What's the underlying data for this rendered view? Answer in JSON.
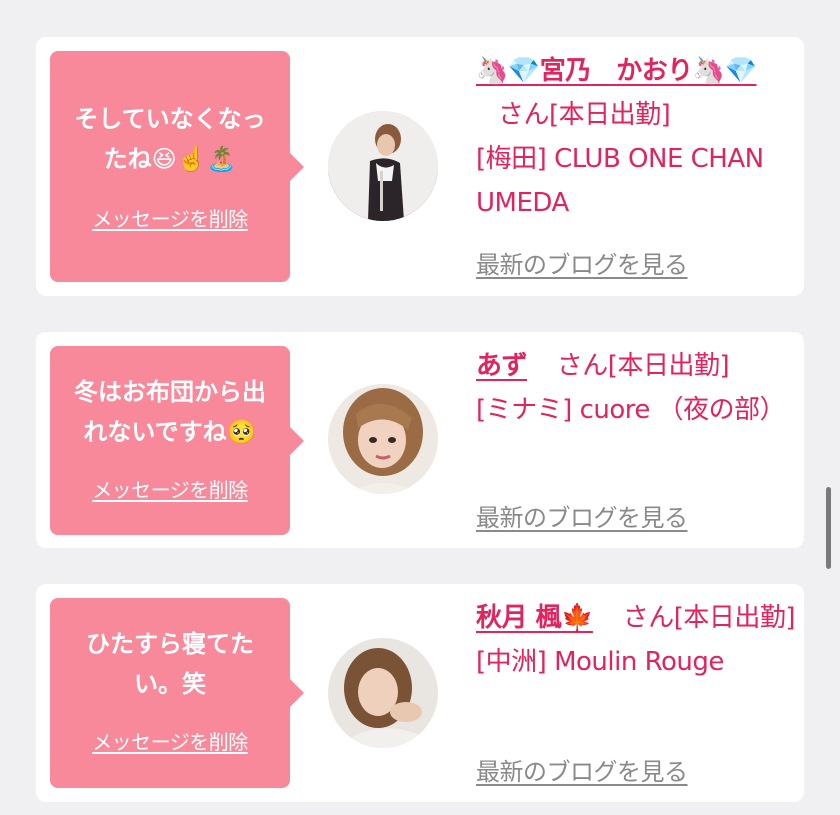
{
  "colors": {
    "accent": "#e0245e",
    "bubble": "#f7899a",
    "background": "#f0f0f2",
    "link_gray": "#8a8a8a"
  },
  "cards": [
    {
      "message_lines": [
        "そしていなくなっ",
        "たね😆☝️🏝️"
      ],
      "delete_label": "メッセージを削除",
      "name": "🦄💎宮乃　かおり🦄💎",
      "san_suffix": "さん",
      "status": "[本日出勤]",
      "area": "[梅田]",
      "shop": "CLUB ONE CHAN UMEDA",
      "blog_label": "最新のブログを見る"
    },
    {
      "message_lines": [
        "冬はお布団から出",
        "れないですね🥺"
      ],
      "delete_label": "メッセージを削除",
      "name": "あず",
      "san_suffix": "さん",
      "status": "[本日出勤]",
      "area": "[ミナミ]",
      "shop": "cuore （夜の部）",
      "blog_label": "最新のブログを見る"
    },
    {
      "message_lines": [
        "ひたすら寝てた",
        "い。笑"
      ],
      "delete_label": "メッセージを削除",
      "name": "秋月 楓🍁",
      "san_suffix": "さん",
      "status": "[本日出勤]",
      "area": "[中洲]",
      "shop": "Moulin Rouge",
      "blog_label": "最新のブログを見る"
    }
  ]
}
